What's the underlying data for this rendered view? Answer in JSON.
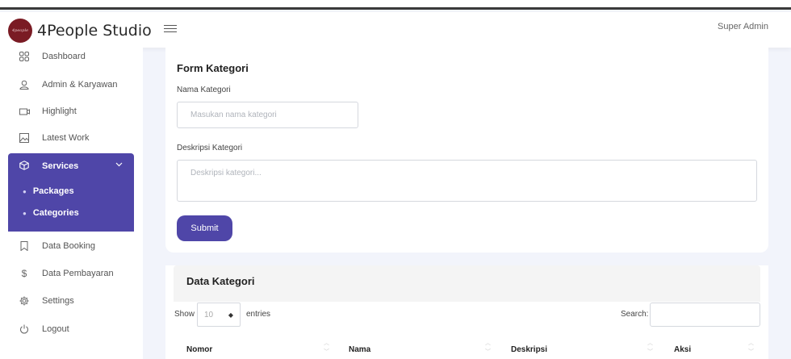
{
  "header": {
    "brand": "4People Studio",
    "user": "Super Admin"
  },
  "sidebar": {
    "items": [
      {
        "label": "Dashboard",
        "icon": "dashboard-icon"
      },
      {
        "label": "Admin & Karyawan",
        "icon": "user-icon"
      },
      {
        "label": "Highlight",
        "icon": "highlight-icon"
      },
      {
        "label": "Latest Work",
        "icon": "image-icon"
      },
      {
        "label": "Data Booking",
        "icon": "bookmark-icon"
      },
      {
        "label": "Data Pembayaran",
        "icon": "dollar-icon"
      },
      {
        "label": "Settings",
        "icon": "gear-icon"
      },
      {
        "label": "Logout",
        "icon": "power-icon"
      }
    ],
    "services": {
      "label": "Services",
      "sub": [
        "Packages",
        "Categories"
      ]
    }
  },
  "form": {
    "title": "Form Kategori",
    "name_label": "Nama Kategori",
    "name_placeholder": "Masukan nama kategori",
    "desc_label": "Deskripsi Kategori",
    "desc_placeholder": "Deskripsi kategori...",
    "submit": "Submit"
  },
  "table": {
    "title": "Data Kategori",
    "show": "Show",
    "entries_value": "10",
    "entries": "entries",
    "search": "Search:",
    "columns": [
      "Nomor",
      "Nama",
      "Deskripsi",
      "Aksi"
    ]
  },
  "colors": {
    "accent": "#4f46a8",
    "background": "#f2f4fb"
  }
}
